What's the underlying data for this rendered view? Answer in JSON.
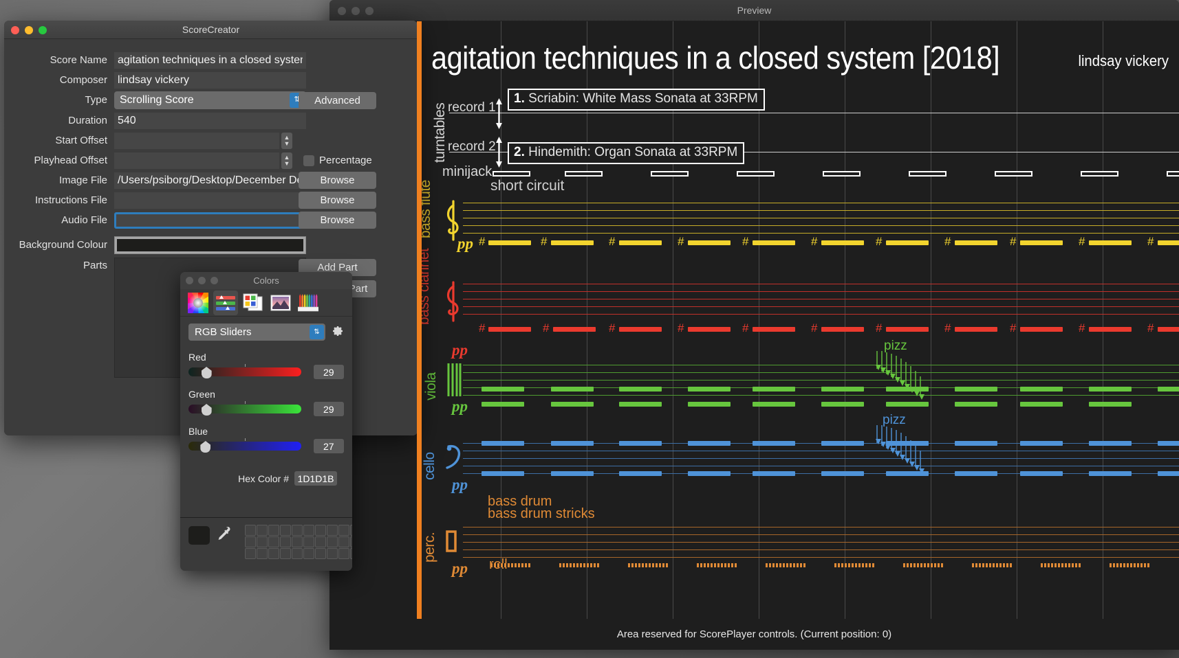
{
  "preview_window": {
    "title": "Preview",
    "footer": "Area reserved for ScorePlayer controls. (Current position: 0)",
    "traffic_lights": [
      "close",
      "minimize",
      "zoom"
    ]
  },
  "score": {
    "title": "agitation techniques in a closed system",
    "year": "[2018]",
    "composer": "lindsay vickery",
    "turntables": {
      "group_label": "turntables",
      "tracks": [
        {
          "label": "record 1",
          "cue_number": "1.",
          "cue_text": "Scriabin: White Mass Sonata at 33RPM"
        },
        {
          "label": "record 2",
          "cue_number": "2.",
          "cue_text": "Hindemith: Organ Sonata at 33RPM"
        }
      ],
      "minijack_label": "minijack",
      "minijack_annotation": "short circuit"
    },
    "staves": [
      {
        "name": "bass\nflute",
        "name_lines": [
          "bass",
          "flute"
        ],
        "clef": "treble",
        "color": "#f0cf2a",
        "dynamic": "pp",
        "accidental": "#",
        "annotation": ""
      },
      {
        "name_lines": [
          "bass",
          "clarinet"
        ],
        "clef": "treble",
        "color": "#e8342c",
        "dynamic": "pp",
        "accidental": "#",
        "annotation": ""
      },
      {
        "name_lines": [
          "viola"
        ],
        "clef": "alto",
        "color": "#64c03c",
        "dynamic": "pp",
        "accidental": "",
        "annotation": "pizz"
      },
      {
        "name_lines": [
          "cello"
        ],
        "clef": "bass",
        "color": "#4f8fd0",
        "dynamic": "pp",
        "accidental": "",
        "annotation": "pizz"
      },
      {
        "name_lines": [
          "perc."
        ],
        "clef": "percussion",
        "color": "#e08a35",
        "dynamic": "pp",
        "accidental": "",
        "annotation": "roll",
        "extra_text": [
          "bass drum",
          "bass drum stricks"
        ]
      }
    ]
  },
  "creator_window": {
    "title": "ScoreCreator",
    "fields": [
      {
        "label": "Score Name",
        "value": "agitation techniques in a closed systen",
        "placeholder": ""
      },
      {
        "label": "Composer",
        "value": "lindsay vickery",
        "placeholder": ""
      },
      {
        "label": "Type",
        "value": "Scrolling Score",
        "placeholder": ""
      },
      {
        "label": "Duration",
        "value": "540",
        "placeholder": ""
      },
      {
        "label": "Start Offset",
        "value": "",
        "placeholder": ""
      },
      {
        "label": "Playhead Offset",
        "value": "",
        "placeholder": ""
      },
      {
        "label": "Image File",
        "value": "/Users/psiborg/Desktop/December Dec",
        "placeholder": ""
      },
      {
        "label": "Instructions File",
        "value": "",
        "placeholder": ""
      },
      {
        "label": "Audio File",
        "value": "",
        "placeholder": ""
      },
      {
        "label": "Background Colour",
        "value": "",
        "placeholder": ""
      },
      {
        "label": "Parts",
        "value": "",
        "placeholder": ""
      }
    ],
    "buttons": {
      "advanced": "Advanced",
      "browse_image": "Browse",
      "browse_instructions": "Browse",
      "browse_audio": "Browse",
      "add_part": "Add Part",
      "remove_part": "Remove Part"
    },
    "percentage_checkbox": {
      "label": "Percentage",
      "checked": false
    },
    "background_colour_value": "#1D1D1B",
    "type_options": [
      "Scrolling Score"
    ]
  },
  "colors_panel": {
    "title": "Colors",
    "tools": [
      "color-wheel-icon",
      "sliders-icon",
      "palettes-icon",
      "image-palette-icon",
      "pencils-icon"
    ],
    "active_tool": "sliders-icon",
    "mode": "RGB Sliders",
    "gear": "gear-icon",
    "sliders": [
      {
        "label": "Red",
        "value": "29",
        "pct": 11.4,
        "from": "#0d2420",
        "to": "#fb1f1f"
      },
      {
        "label": "Green",
        "value": "29",
        "pct": 11.4,
        "from": "#2a0d26",
        "to": "#3ae53a"
      },
      {
        "label": "Blue",
        "value": "27",
        "pct": 10.6,
        "from": "#2a2a08",
        "to": "#2020f5"
      }
    ],
    "hex_label": "Hex Color #",
    "hex_value": "1D1D1B",
    "eyedropper": "eyedropper-icon",
    "current_swatch_color": "#1D1D1B",
    "swatch_rows": 3,
    "swatch_cols": 10
  }
}
